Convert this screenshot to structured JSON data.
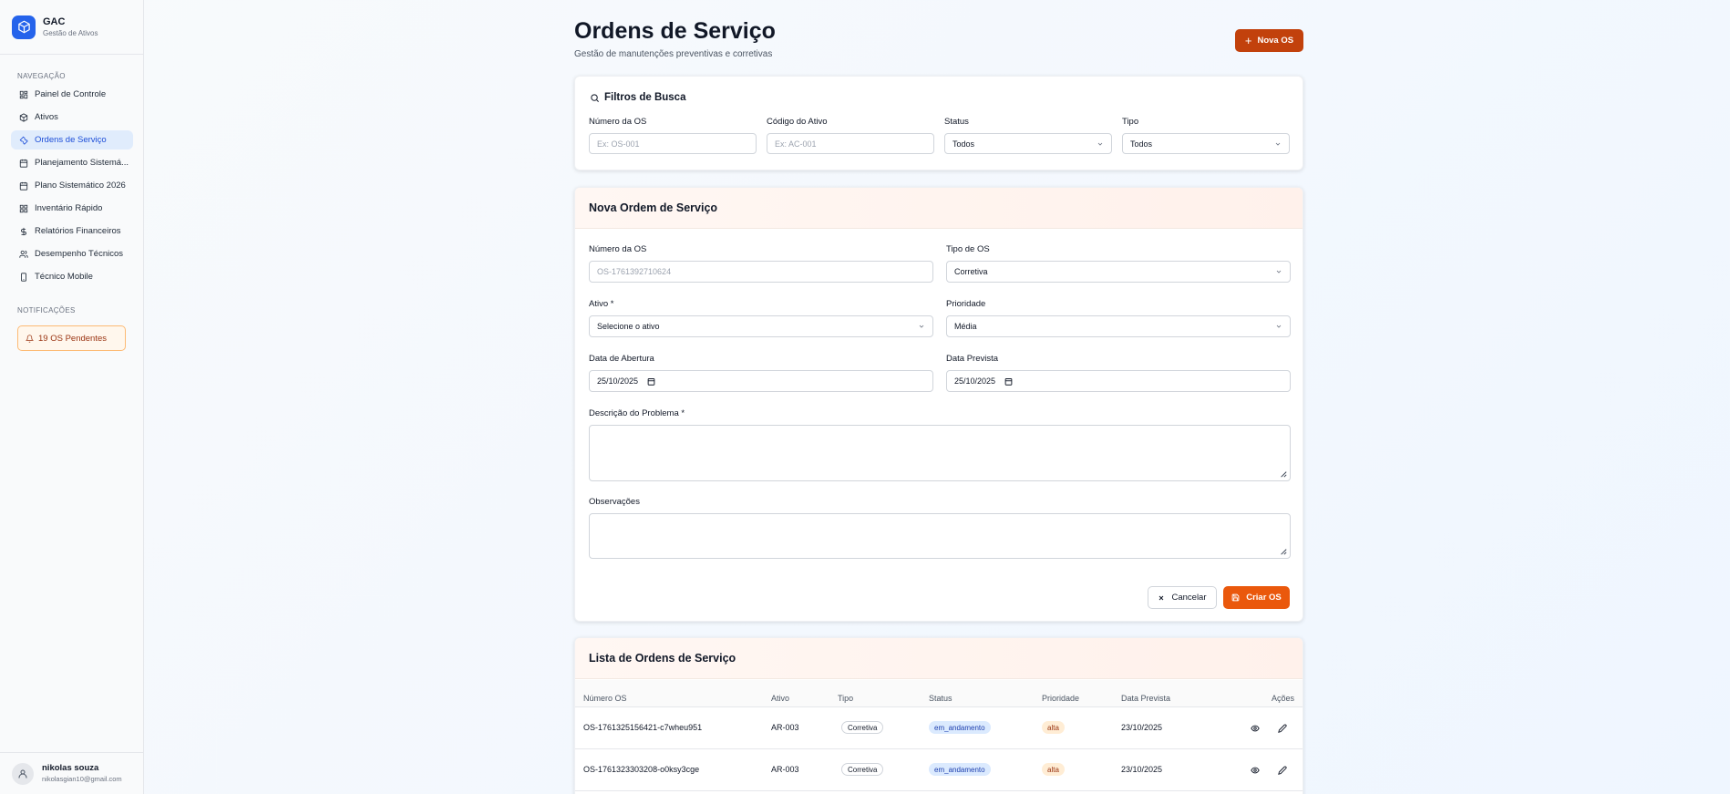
{
  "brand": {
    "title": "GAC",
    "subtitle": "Gestão de Ativos"
  },
  "sidebar": {
    "nav_label": "NAVEGAÇÃO",
    "items": [
      {
        "label": "Painel de Controle",
        "icon": "dashboard-icon"
      },
      {
        "label": "Ativos",
        "icon": "box-icon"
      },
      {
        "label": "Ordens de Serviço",
        "icon": "wrench-icon",
        "active": true
      },
      {
        "label": "Planejamento Sistemá...",
        "icon": "calendar-icon"
      },
      {
        "label": "Plano Sistemático 2026",
        "icon": "calendar-icon"
      },
      {
        "label": "Inventário Rápido",
        "icon": "grid-icon"
      },
      {
        "label": "Relatórios Financeiros",
        "icon": "dollar-icon"
      },
      {
        "label": "Desempenho Técnicos",
        "icon": "users-icon"
      },
      {
        "label": "Técnico Mobile",
        "icon": "phone-icon"
      }
    ],
    "notif_label": "NOTIFICAÇÕES",
    "notif_text": "19 OS Pendentes"
  },
  "user": {
    "name": "nikolas souza",
    "email": "nikolasgian10@gmail.com"
  },
  "header": {
    "title": "Ordens de Serviço",
    "subtitle": "Gestão de manutenções preventivas e corretivas",
    "new_button": "Nova OS"
  },
  "filters": {
    "title": "Filtros de Busca",
    "os_label": "Número da OS",
    "os_placeholder": "Ex: OS-001",
    "asset_label": "Código do Ativo",
    "asset_placeholder": "Ex: AC-001",
    "status_label": "Status",
    "status_value": "Todos",
    "type_label": "Tipo",
    "type_value": "Todos"
  },
  "form": {
    "title": "Nova Ordem de Serviço",
    "os_label": "Número da OS",
    "os_placeholder": "OS-1761392710624",
    "type_label": "Tipo de OS",
    "type_value": "Corretiva",
    "asset_label": "Ativo *",
    "asset_value": "Selecione o ativo",
    "priority_label": "Prioridade",
    "priority_value": "Média",
    "open_label": "Data de Abertura",
    "open_value": "25/10/2025",
    "due_label": "Data Prevista",
    "due_value": "25/10/2025",
    "desc_label": "Descrição do Problema *",
    "obs_label": "Observações",
    "cancel": "Cancelar",
    "create": "Criar OS"
  },
  "list": {
    "title": "Lista de Ordens de Serviço",
    "columns": [
      "Número OS",
      "Ativo",
      "Tipo",
      "Status",
      "Prioridade",
      "Data Prevista",
      "Ações"
    ],
    "rows": [
      {
        "os": "OS-1761325156421-c7wheu951",
        "asset": "AR-003",
        "type": "Corretiva",
        "status": "em_andamento",
        "priority": "alta",
        "due": "23/10/2025"
      },
      {
        "os": "OS-1761323303208-o0ksy3cge",
        "asset": "AR-003",
        "type": "Corretiva",
        "status": "em_andamento",
        "priority": "alta",
        "due": "23/10/2025"
      }
    ]
  },
  "colors": {
    "primary": "#2563eb",
    "accent": "#ea580c",
    "accent_dark": "#c2410c"
  }
}
